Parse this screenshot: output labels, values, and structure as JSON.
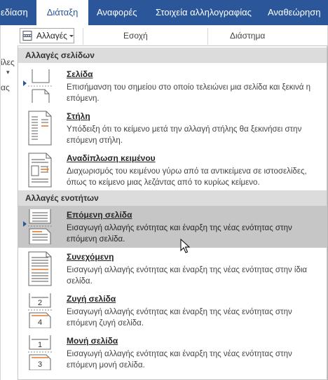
{
  "ribbon_tabs": [
    "εδίαση",
    "Διάταξη",
    "Αναφορές",
    "Στοιχεία αλληλογραφίας",
    "Αναθεώρηση"
  ],
  "left_fragments": [
    "ίλες",
    "ας"
  ],
  "ribbon": {
    "breaks_label": "Αλλαγές",
    "indent_label": "Εσοχή",
    "spacing_label": "Διάστημα"
  },
  "menu": {
    "page_breaks_header": "Αλλαγές σελίδων",
    "section_breaks_header": "Αλλαγές ενοτήτων",
    "items": [
      {
        "title": "Σελίδα",
        "desc": "Επισήμανση του σημείου στο οποίο τελειώνει μια σελίδα και ξεκινά η επόμενη."
      },
      {
        "title": "Στήλη",
        "desc": "Υπόδειξη ότι το κείμενο μετά την αλλαγή στήλης θα ξεκινήσει στην επόμενη στήλη."
      },
      {
        "title": "Αναδίπλωση κειμένου",
        "desc": "Διαχωρισμός του κειμένου γύρω από τα αντικείμενα σε ιστοσελίδες, όπως το κείμενο μιας λεζάντας από το κυρίως κείμενο."
      },
      {
        "title": "Επόμενη σελίδα",
        "desc": "Εισαγωγή αλλαγής ενότητας και έναρξη της νέας ενότητας στην επόμενη σελίδα."
      },
      {
        "title": "Συνεχόμενη",
        "desc": "Εισαγωγή αλλαγής ενότητας και έναρξη της νέας ενότητας στην ίδια σελίδα."
      },
      {
        "title": "Ζυγή σελίδα",
        "desc": "Εισαγωγή αλλαγής ενότητας και έναρξη της νέας ενότητας στην επόμενη ζυγή σελίδα."
      },
      {
        "title": "Μονή σελίδα",
        "desc": "Εισαγωγή αλλαγής ενότητας και έναρξη της νέας ενότητας στην επόμενη μονή σελίδα."
      }
    ],
    "even_icon_numbers": [
      "2",
      "4"
    ],
    "odd_icon_numbers": [
      "1",
      "3"
    ]
  },
  "colors": {
    "accent": "#2b579a",
    "highlight": "#c6c6c6",
    "section_header": "#dcdcdc",
    "orange_mark": "#e07a2e"
  }
}
